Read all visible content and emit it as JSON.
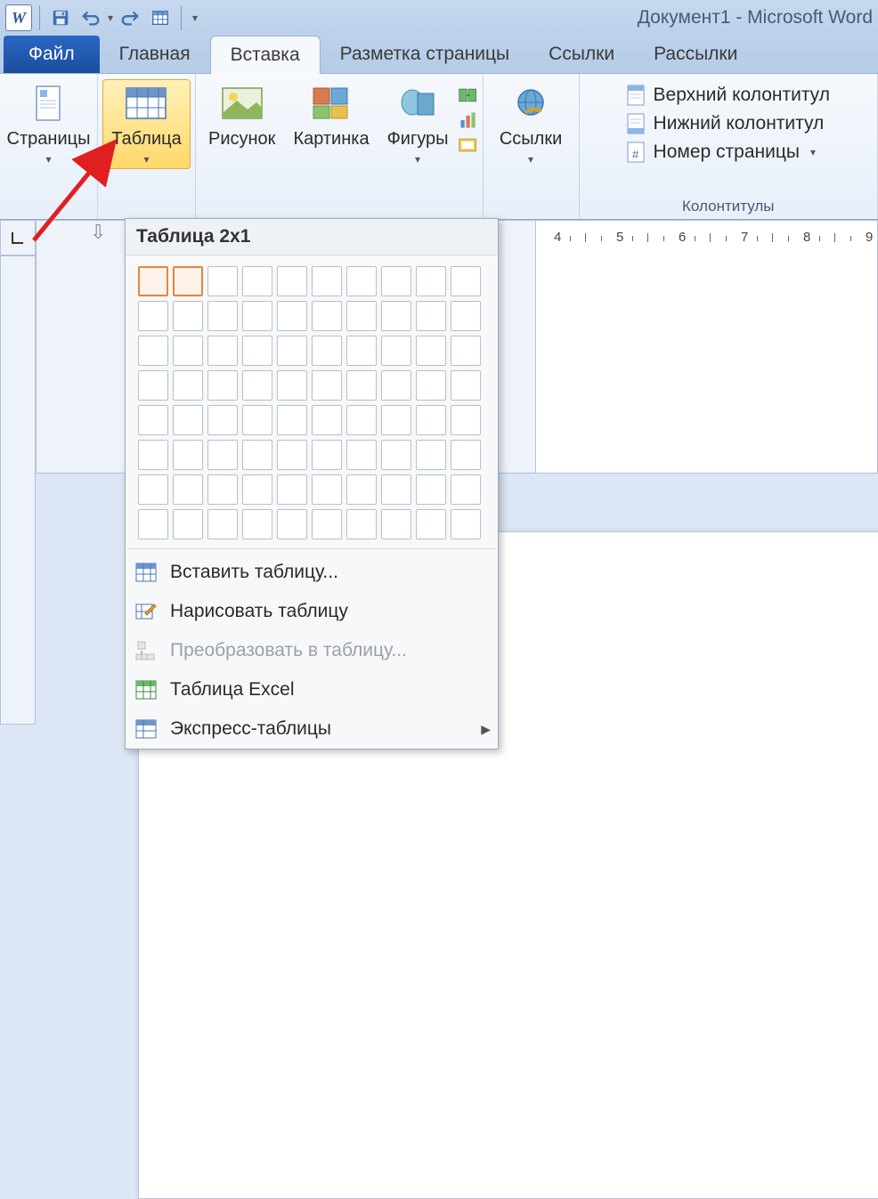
{
  "titlebar": {
    "app_letter": "W",
    "title": "Документ1  -  Microsoft Word"
  },
  "tabs": {
    "file": "Файл",
    "home": "Главная",
    "insert": "Вставка",
    "layout": "Разметка страницы",
    "refs": "Ссылки",
    "mail": "Рассылки"
  },
  "ribbon": {
    "pages": "Страницы",
    "table": "Таблица",
    "picture": "Рисунок",
    "clipart": "Картинка",
    "shapes": "Фигуры",
    "links": "Ссылки",
    "header": "Верхний колонтитул",
    "footer": "Нижний колонтитул",
    "pagenum": "Номер страницы",
    "headers_group": "Колонтитулы"
  },
  "table_menu": {
    "header": "Таблица 2x1",
    "insert": "Вставить таблицу...",
    "draw": "Нарисовать таблицу",
    "convert": "Преобразовать в таблицу...",
    "excel": "Таблица Excel",
    "quick": "Экспресс-таблицы"
  },
  "ruler_h": [
    "4",
    "5",
    "6",
    "7",
    "8",
    "9"
  ]
}
